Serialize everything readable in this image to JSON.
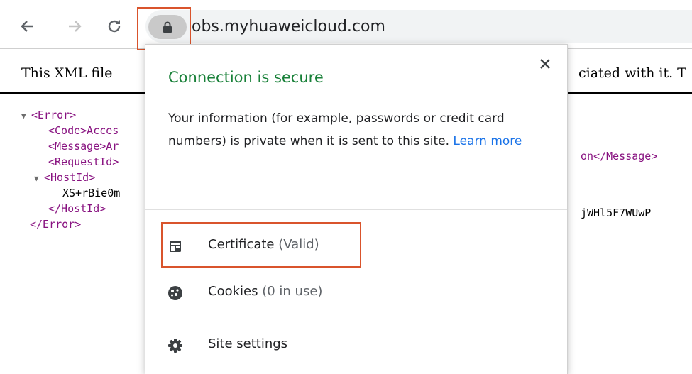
{
  "toolbar": {
    "url": "obs.myhuaweicloud.com",
    "back_icon": "arrow-left-icon",
    "forward_icon": "arrow-right-icon",
    "reload_icon": "reload-icon",
    "lock_icon": "lock-icon",
    "highlight_color": "#d9542c"
  },
  "page": {
    "notice_left": "This XML file",
    "notice_right": "ciated with it. T",
    "xml": {
      "error_open": "<Error>",
      "code": "<Code>Acces",
      "message_left": "<Message>Ar",
      "message_right": "on</Message>",
      "request_id": "<RequestId>",
      "host_id_open": "<HostId>",
      "host_id_left": "XS+rBie0m",
      "host_id_right": "jWHl5F7WUwP",
      "host_id_close": "</HostId>",
      "error_close": "</Error>"
    }
  },
  "popup": {
    "title": "Connection is secure",
    "title_color": "#188038",
    "description": "Your information (for example, passwords or credit card numbers) is private when it is sent to this site.",
    "learn_more": "Learn more",
    "close_icon": "close-icon",
    "items": [
      {
        "icon": "certificate-icon",
        "label": "Certificate",
        "status": "(Valid)"
      },
      {
        "icon": "cookie-icon",
        "label": "Cookies",
        "status": "(0 in use)"
      },
      {
        "icon": "gear-icon",
        "label": "Site settings",
        "status": ""
      }
    ]
  }
}
